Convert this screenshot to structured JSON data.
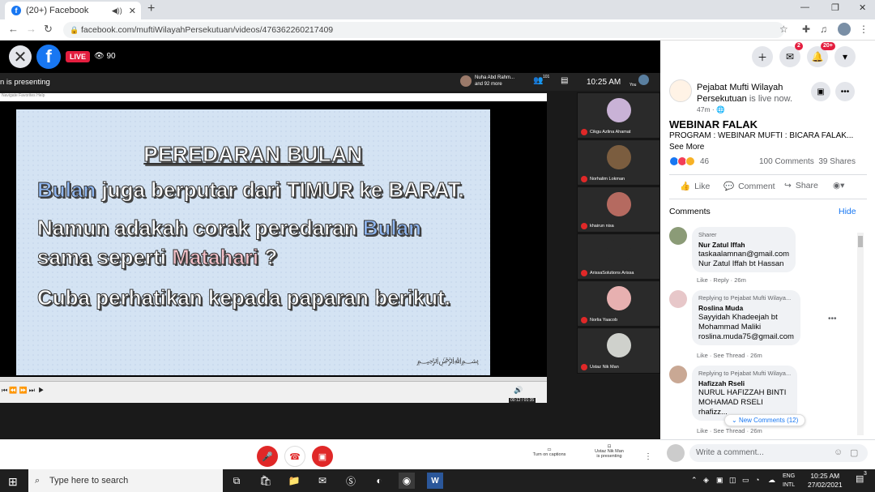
{
  "browser": {
    "tab_title": "(20+) Facebook",
    "tab_favicon": "f",
    "url": "facebook.com/muftiWilayahPersekutuan/videos/476362260217409"
  },
  "video": {
    "live_label": "LIVE",
    "viewers": "90"
  },
  "zoom": {
    "presenting_text": "n is presenting",
    "participants_label": "Nuha Abd Rahm...",
    "participants_more": "and 92 more",
    "time": "10:25 AM",
    "participants_count": "101",
    "you_label": "You",
    "share_menu": "Navigate  Favorites  Help",
    "slide": {
      "title_part1": "PEREDARAN ",
      "title_part2": "BULAN",
      "line1_a": "Bulan",
      "line1_b": " juga berputar dari TIMUR ke BARAT.",
      "line2_a": "Namun  adakah  corak  peredaran  ",
      "line2_b": "Bulan",
      "line3_a": "sama seperti ",
      "line3_b": "Matahari",
      "line3_c": " ?",
      "line4": "Cuba perhatikan kepada paparan berikut.",
      "signature": "بادالہ دار کا مسلم"
    },
    "player_time": "00:12 / 01:35",
    "gallery": [
      {
        "name": "Cikgu Azlina Ahamat",
        "color": "#c9b2d6"
      },
      {
        "name": "Norhalim Lokman",
        "color": "#7b5d3f"
      },
      {
        "name": "khairun nisa",
        "color": "#b56a60"
      },
      {
        "name": "ArissaSolutions Arissa",
        "color": "#2a2a2a"
      },
      {
        "name": "Norlia Yaacob",
        "color": "#e7b0b0"
      },
      {
        "name": "Ustaz Nik Man",
        "color": "#cfd1cc"
      }
    ],
    "captions_label": "Turn on captions",
    "presenting_label_1": "Ustaz Nik Man",
    "presenting_label_2": "is presenting"
  },
  "panel": {
    "messenger_badge": "2",
    "notif_badge": "20+",
    "page_name": "Pejabat Mufti Wilayah Persekutuan",
    "live_now": " is live now.",
    "time_ago": "47m · ",
    "webinar_title": "WEBINAR FALAK",
    "desc": "PROGRAM : WEBINAR MUFTI : BICARA FALAK...",
    "see_more": "See More",
    "reaction_count": "46",
    "comments_count": "100 Comments",
    "shares_count": "39 Shares",
    "like_label": "Like",
    "comment_label": "Comment",
    "share_label": "Share",
    "comments_header": "Comments",
    "hide_label": "Hide",
    "comments": [
      {
        "sub": "Sharer",
        "name": "Nur Zatul Iffah",
        "lines": [
          "taskaalamnan@gmail.com",
          "Nur Zatul Iffah bt Hassan"
        ],
        "meta": "Like · Reply · 26m"
      },
      {
        "sub": "Replying to Pejabat Mufti Wilaya...",
        "name": "Roslina Muda",
        "lines": [
          "Sayyidah Khadeejah bt",
          "Mohammad Maliki",
          "roslina.muda75@gmail.com"
        ],
        "meta": "Like · See Thread · 26m"
      },
      {
        "sub": "Replying to Pejabat Mufti Wilaya...",
        "name": "Hafizzah Rseli",
        "lines": [
          "NURUL HAFIZZAH BINTI",
          "MOHAMAD RSELI",
          "rhafizz..."
        ],
        "meta": "Like · See Thread · 26m"
      }
    ],
    "new_comments": "New Comments (12)",
    "write_placeholder": "Write a comment..."
  },
  "taskbar": {
    "search_placeholder": "Type here to search",
    "lang_1": "ENG",
    "lang_2": "INTL",
    "time": "10:25 AM",
    "date": "27/02/2021",
    "notif_count": "3"
  }
}
